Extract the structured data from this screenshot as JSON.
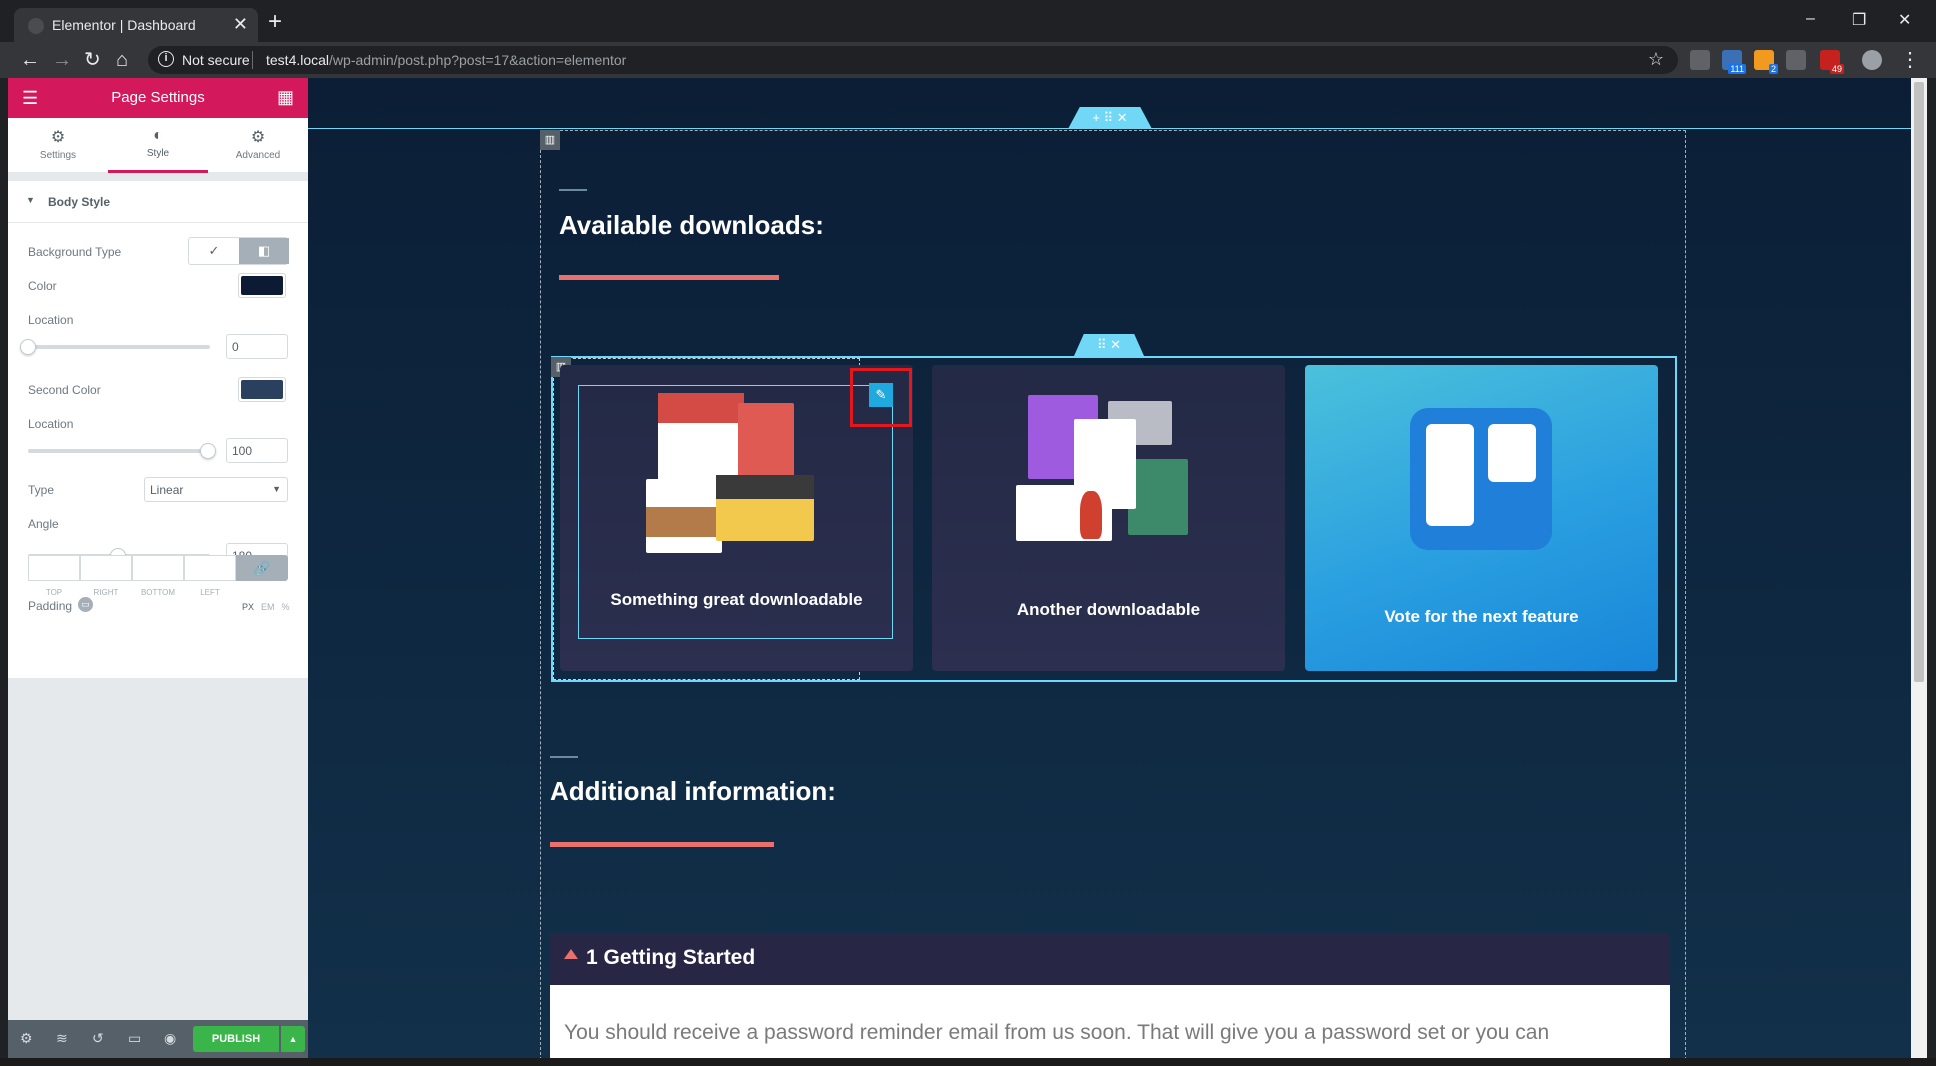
{
  "browser": {
    "tab_title": "Elementor | Dashboard",
    "tab_close": "✕",
    "new_tab": "+",
    "security_label": "Not secure",
    "url_host": "test4.local",
    "url_path": "/wp-admin/post.php?post=17&action=elementor",
    "window_controls": [
      "–",
      "❐",
      "✕"
    ],
    "extension_badges": [
      "111",
      "2",
      "49"
    ]
  },
  "panel": {
    "header_title": "Page Settings",
    "tabs": [
      {
        "label": "Settings",
        "icon": "gear-icon"
      },
      {
        "label": "Style",
        "icon": "half-circle-icon"
      },
      {
        "label": "Advanced",
        "icon": "cog-icon"
      }
    ],
    "active_tab": "Style",
    "section_title": "Body Style",
    "controls": {
      "background_type_label": "Background Type",
      "background_type_selected": "gradient",
      "color_label": "Color",
      "color_value": "#0d1a33",
      "location_label": "Location",
      "location_value": "0",
      "second_color_label": "Second Color",
      "second_color_value": "#2b3f5e",
      "location2_label": "Location",
      "location2_value": "100",
      "type_label": "Type",
      "type_value": "Linear",
      "angle_label": "Angle",
      "angle_value": "180",
      "padding_label": "Padding",
      "units": [
        "PX",
        "EM",
        "%"
      ],
      "dimension_labels": [
        "TOP",
        "RIGHT",
        "BOTTOM",
        "LEFT"
      ]
    },
    "footer": {
      "publish_label": "PUBLISH",
      "publish_more": "▲"
    }
  },
  "preview": {
    "section_handle": "+ ⠿ ✕",
    "inner_handle": "⠿ ✕",
    "heading_downloads": "Available downloads:",
    "heading_additional": "Additional information:",
    "cards": [
      {
        "caption": "Something great downloadable"
      },
      {
        "caption": "Another downloadable"
      },
      {
        "caption": "Vote for the next feature"
      }
    ],
    "accordion_title": "1 Getting Started",
    "accordion_body": "You should receive a password reminder email from us soon. That will give you a password set or you can"
  },
  "colors": {
    "brand": "#d3185c",
    "publish": "#39b54a",
    "accent_line": "#e8716b",
    "editor_outline": "#71d7f7",
    "highlight_box": "#e3171c"
  }
}
